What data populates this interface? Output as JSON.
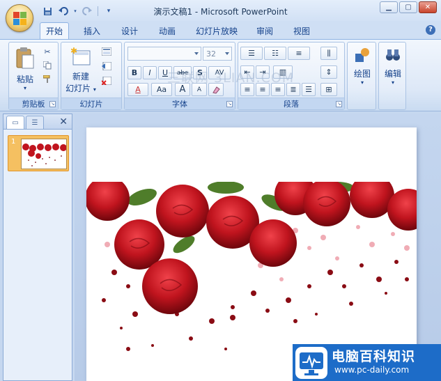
{
  "window": {
    "title": "演示文稿1 - Microsoft PowerPoint",
    "minimize_icon": "minimize-icon",
    "maximize_icon": "maximize-icon",
    "close_icon": "close-icon"
  },
  "quick_access": [
    "save-icon",
    "undo-icon",
    "redo-icon",
    "customize-icon"
  ],
  "tabs": [
    {
      "label": "开始",
      "active": true
    },
    {
      "label": "插入"
    },
    {
      "label": "设计"
    },
    {
      "label": "动画"
    },
    {
      "label": "幻灯片放映"
    },
    {
      "label": "审阅"
    },
    {
      "label": "视图"
    }
  ],
  "ribbon": {
    "clipboard": {
      "label": "剪贴板",
      "paste": "粘贴"
    },
    "slides": {
      "label": "幻灯片",
      "new_slide_line1": "新建",
      "new_slide_line2": "幻灯片"
    },
    "font": {
      "label": "字体",
      "font_name": "",
      "font_size": "32",
      "buttons": [
        "B",
        "I",
        "U",
        "abc",
        "S",
        "AV"
      ],
      "color_buttons": [
        "A",
        "Aa",
        "A",
        "A"
      ]
    },
    "paragraph": {
      "label": "段落"
    },
    "drawing": {
      "label": "绘图"
    },
    "editing": {
      "label": "编辑"
    }
  },
  "watermark_text": "三联网 3LIAN.COM",
  "slide_pane": {
    "slide_number": "1"
  },
  "logo": {
    "title": "电脑百科知识",
    "url": "www.pc-daily.com"
  },
  "colors": {
    "accent": "#15428b",
    "rose": "#c0141e",
    "logo_blue": "#1d6cc8"
  }
}
